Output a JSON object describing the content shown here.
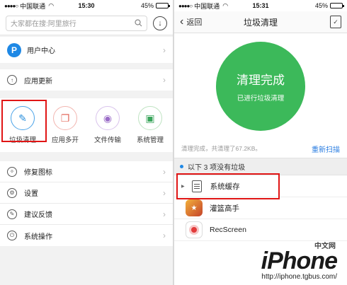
{
  "left_screen": {
    "status": {
      "carrier": "中国联通",
      "time": "15:30",
      "battery": "45%",
      "battery_level": 0.45
    },
    "search": {
      "placeholder": "大家都在搜:阿里旅行"
    },
    "user_center": {
      "badge": "P",
      "label": "用户中心"
    },
    "app_update": {
      "label": "应用更新"
    },
    "tools": [
      {
        "label": "垃圾清理",
        "icon": "broom-icon"
      },
      {
        "label": "应用多开",
        "icon": "copy-icon"
      },
      {
        "label": "文件传输",
        "icon": "wireless-icon"
      },
      {
        "label": "系统管理",
        "icon": "toolbox-icon"
      }
    ],
    "menu": [
      {
        "label": "修复图标",
        "icon": "repair-icon"
      },
      {
        "label": "设置",
        "icon": "gear-icon"
      },
      {
        "label": "建议反馈",
        "icon": "pencil-icon"
      },
      {
        "label": "系统操作",
        "icon": "power-icon"
      }
    ]
  },
  "right_screen": {
    "status": {
      "carrier": "中国联通",
      "time": "15:31",
      "battery": "45%",
      "battery_level": 0.45
    },
    "nav": {
      "back": "返回",
      "title": "垃圾清理"
    },
    "result": {
      "headline": "清理完成",
      "subline": "已进行垃圾清理"
    },
    "summary": {
      "text": "清理完成，共清理了67.2KB。",
      "rescan": "重新扫描"
    },
    "section_header": "以下 3 项没有垃圾",
    "items": [
      {
        "label": "系统缓存"
      },
      {
        "label": "灌篮高手"
      },
      {
        "label": "RecScreen"
      }
    ]
  },
  "watermark": {
    "zh": "中文网",
    "brand": "iPhone",
    "url": "http://iphone.tgbus.com/"
  },
  "colors": {
    "green": "#3cb95a",
    "blue": "#2a7de1",
    "highlight": "#e01515"
  }
}
